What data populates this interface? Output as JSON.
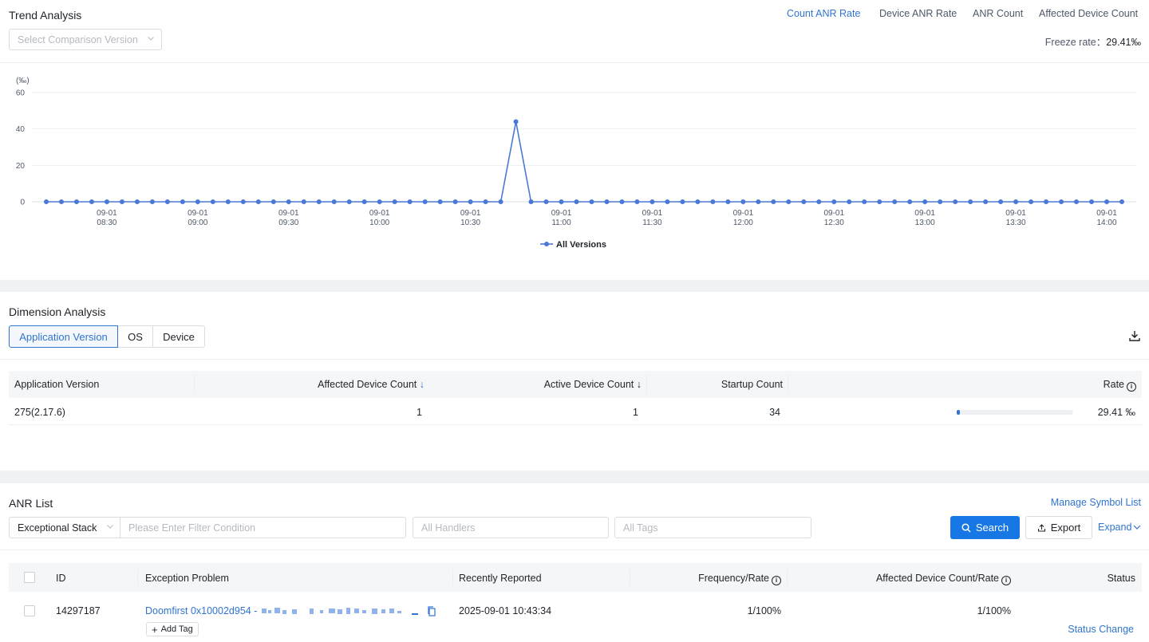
{
  "trend": {
    "title": "Trend Analysis",
    "comparison_placeholder": "Select Comparison Version",
    "metric_tabs": [
      "Count ANR Rate",
      "Device ANR Rate",
      "ANR Count",
      "Affected Device Count"
    ],
    "active_metric": "Count ANR Rate",
    "freeze_label": "Freeze rate：",
    "freeze_value": "29.41‰",
    "accent_color": "#2f74d0"
  },
  "chart_data": {
    "type": "line",
    "ylabel": "(‰)",
    "ylim": [
      0,
      60
    ],
    "y_ticks": [
      0,
      20,
      40,
      60
    ],
    "x_ticks": [
      [
        "09-01",
        "08:30"
      ],
      [
        "09-01",
        "09:00"
      ],
      [
        "09-01",
        "09:30"
      ],
      [
        "09-01",
        "10:00"
      ],
      [
        "09-01",
        "10:30"
      ],
      [
        "09-01",
        "11:00"
      ],
      [
        "09-01",
        "11:30"
      ],
      [
        "09-01",
        "12:00"
      ],
      [
        "09-01",
        "12:30"
      ],
      [
        "09-01",
        "13:00"
      ],
      [
        "09-01",
        "13:30"
      ],
      [
        "09-01",
        "14:00"
      ]
    ],
    "x_range": [
      "08:10",
      "14:05"
    ],
    "grid": true,
    "legend": "bottom-center",
    "series": [
      {
        "name": "All Versions",
        "color": "#4a78d6",
        "x": [
          "08:10",
          "08:15",
          "08:20",
          "08:25",
          "08:30",
          "08:35",
          "08:40",
          "08:45",
          "08:50",
          "08:55",
          "09:00",
          "09:05",
          "09:10",
          "09:15",
          "09:20",
          "09:25",
          "09:30",
          "09:35",
          "09:40",
          "09:45",
          "09:50",
          "09:55",
          "10:00",
          "10:05",
          "10:10",
          "10:15",
          "10:20",
          "10:25",
          "10:30",
          "10:35",
          "10:40",
          "10:45",
          "10:50",
          "10:55",
          "11:00",
          "11:05",
          "11:10",
          "11:15",
          "11:20",
          "11:25",
          "11:30",
          "11:35",
          "11:40",
          "11:45",
          "11:50",
          "11:55",
          "12:00",
          "12:05",
          "12:10",
          "12:15",
          "12:20",
          "12:25",
          "12:30",
          "12:35",
          "12:40",
          "12:45",
          "12:50",
          "12:55",
          "13:00",
          "13:05",
          "13:10",
          "13:15",
          "13:20",
          "13:25",
          "13:30",
          "13:35",
          "13:40",
          "13:45",
          "13:50",
          "13:55",
          "14:00",
          "14:05"
        ],
        "values": [
          0,
          0,
          0,
          0,
          0,
          0,
          0,
          0,
          0,
          0,
          0,
          0,
          0,
          0,
          0,
          0,
          0,
          0,
          0,
          0,
          0,
          0,
          0,
          0,
          0,
          0,
          0,
          0,
          0,
          0,
          0,
          44,
          0,
          0,
          0,
          0,
          0,
          0,
          0,
          0,
          0,
          0,
          0,
          0,
          0,
          0,
          0,
          0,
          0,
          0,
          0,
          0,
          0,
          0,
          0,
          0,
          0,
          0,
          0,
          0,
          0,
          0,
          0,
          0,
          0,
          0,
          0,
          0,
          0,
          0,
          0,
          0
        ]
      }
    ]
  },
  "dimension": {
    "title": "Dimension Analysis",
    "tabs": [
      "Application Version",
      "OS",
      "Device"
    ],
    "active_tab": "Application Version",
    "columns": [
      "Application Version",
      "Affected Device Count",
      "Active Device Count",
      "Startup Count",
      "Rate"
    ],
    "sort_arrow": "↓",
    "rows": [
      {
        "version": "275(2.17.6)",
        "affected": "1",
        "active": "1",
        "startup": "34",
        "rate": "29.41 ‰",
        "rate_fraction": 0.03
      }
    ]
  },
  "anr": {
    "title": "ANR List",
    "manage_symbol": "Manage Symbol List",
    "filter_type": "Exceptional Stack",
    "filter_placeholder": "Please Enter Filter Condition",
    "handlers_placeholder": "All Handlers",
    "tags_placeholder": "All Tags",
    "search_label": "Search",
    "export_label": "Export",
    "expand_label": "Expand",
    "columns": [
      "ID",
      "Exception Problem",
      "Recently Reported",
      "Frequency/Rate",
      "Affected Device Count/Rate",
      "Status"
    ],
    "rows": [
      {
        "id": "14297187",
        "problem": "Doomfirst 0x10002d954 -",
        "reported": "2025-09-01 10:43:34",
        "frequency": "1/100%",
        "affected": "1/100%",
        "add_tag": "Add Tag",
        "status_change": "Status Change"
      }
    ]
  }
}
